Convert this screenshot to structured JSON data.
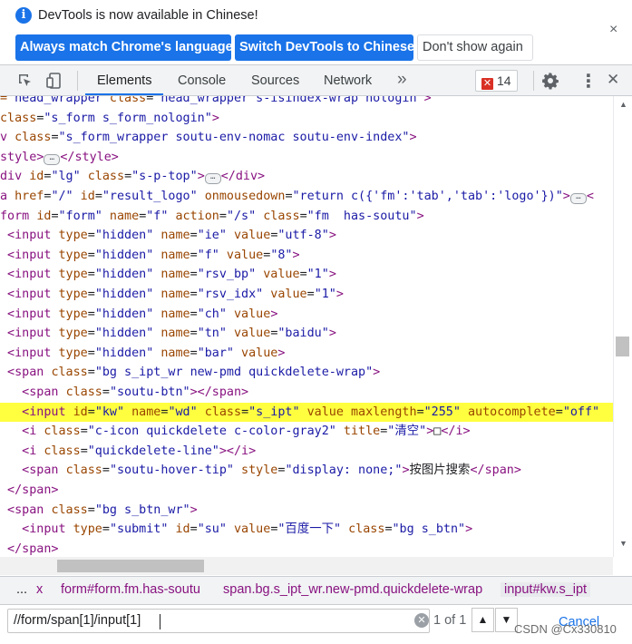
{
  "banner": {
    "message": "DevTools is now available in Chinese!",
    "btn_match": "Always match Chrome's language",
    "btn_switch": "Switch DevTools to Chinese",
    "btn_dont_show": "Don't show again",
    "close": "×",
    "info_glyph": "i"
  },
  "toolbar": {
    "tabs": [
      "Elements",
      "Console",
      "Sources",
      "Network"
    ],
    "more": "»",
    "error_count": "14",
    "error_glyph": "✕",
    "close": "✕",
    "kebab": "⋮"
  },
  "colors": {
    "accent": "#1a73e8",
    "highlight": "#ffff40",
    "tag": "#881280",
    "attr": "#994500",
    "value": "#1a1aa6"
  },
  "code_lines": [
    {
      "segs": [
        [
          "a",
          "= "
        ],
        [
          "v",
          "head_wrapper"
        ],
        [
          "a",
          " class"
        ],
        [
          "x",
          "="
        ],
        [
          "v",
          "\"head_wrapper s-isindex-wrap nologin\""
        ],
        [
          "t",
          ">"
        ]
      ]
    },
    {
      "segs": [
        [
          "a",
          "class"
        ],
        [
          "x",
          "="
        ],
        [
          "v",
          "\"s_form s_form_nologin\""
        ],
        [
          "t",
          ">"
        ]
      ]
    },
    {
      "segs": [
        [
          "t",
          "v "
        ],
        [
          "a",
          "class"
        ],
        [
          "x",
          "="
        ],
        [
          "v",
          "\"s_form_wrapper soutu-env-nomac soutu-env-index\""
        ],
        [
          "t",
          ">"
        ]
      ]
    },
    {
      "segs": [
        [
          "t",
          "style>"
        ],
        [
          "e",
          "…"
        ],
        [
          "t",
          "</style>"
        ]
      ]
    },
    {
      "segs": [
        [
          "t",
          "div "
        ],
        [
          "a",
          "id"
        ],
        [
          "x",
          "="
        ],
        [
          "v",
          "\"lg\""
        ],
        [
          "a",
          " class"
        ],
        [
          "x",
          "="
        ],
        [
          "v",
          "\"s-p-top\""
        ],
        [
          "t",
          ">"
        ],
        [
          "e",
          "…"
        ],
        [
          "t",
          "</div>"
        ]
      ]
    },
    {
      "segs": [
        [
          "t",
          "a "
        ],
        [
          "a",
          "href"
        ],
        [
          "x",
          "="
        ],
        [
          "v",
          "\"/\""
        ],
        [
          "a",
          " id"
        ],
        [
          "x",
          "="
        ],
        [
          "v",
          "\"result_logo\""
        ],
        [
          "a",
          " onmousedown"
        ],
        [
          "x",
          "="
        ],
        [
          "v",
          "\"return c({'fm':'tab','tab':'logo'})\""
        ],
        [
          "t",
          ">"
        ],
        [
          "e",
          "…"
        ],
        [
          "t",
          "<"
        ]
      ]
    },
    {
      "segs": [
        [
          "t",
          "form "
        ],
        [
          "a",
          "id"
        ],
        [
          "x",
          "="
        ],
        [
          "v",
          "\"form\""
        ],
        [
          "a",
          " name"
        ],
        [
          "x",
          "="
        ],
        [
          "v",
          "\"f\""
        ],
        [
          "a",
          " action"
        ],
        [
          "x",
          "="
        ],
        [
          "v",
          "\"/s\""
        ],
        [
          "a",
          " class"
        ],
        [
          "x",
          "="
        ],
        [
          "v",
          "\"fm  has-soutu\""
        ],
        [
          "t",
          ">"
        ]
      ]
    },
    {
      "segs": [
        [
          "t",
          " <input "
        ],
        [
          "a",
          "type"
        ],
        [
          "x",
          "="
        ],
        [
          "v",
          "\"hidden\""
        ],
        [
          "a",
          " name"
        ],
        [
          "x",
          "="
        ],
        [
          "v",
          "\"ie\""
        ],
        [
          "a",
          " value"
        ],
        [
          "x",
          "="
        ],
        [
          "v",
          "\"utf-8\""
        ],
        [
          "t",
          ">"
        ]
      ]
    },
    {
      "segs": [
        [
          "t",
          " <input "
        ],
        [
          "a",
          "type"
        ],
        [
          "x",
          "="
        ],
        [
          "v",
          "\"hidden\""
        ],
        [
          "a",
          " name"
        ],
        [
          "x",
          "="
        ],
        [
          "v",
          "\"f\""
        ],
        [
          "a",
          " value"
        ],
        [
          "x",
          "="
        ],
        [
          "v",
          "\"8\""
        ],
        [
          "t",
          ">"
        ]
      ]
    },
    {
      "segs": [
        [
          "t",
          " <input "
        ],
        [
          "a",
          "type"
        ],
        [
          "x",
          "="
        ],
        [
          "v",
          "\"hidden\""
        ],
        [
          "a",
          " name"
        ],
        [
          "x",
          "="
        ],
        [
          "v",
          "\"rsv_bp\""
        ],
        [
          "a",
          " value"
        ],
        [
          "x",
          "="
        ],
        [
          "v",
          "\"1\""
        ],
        [
          "t",
          ">"
        ]
      ]
    },
    {
      "segs": [
        [
          "t",
          " <input "
        ],
        [
          "a",
          "type"
        ],
        [
          "x",
          "="
        ],
        [
          "v",
          "\"hidden\""
        ],
        [
          "a",
          " name"
        ],
        [
          "x",
          "="
        ],
        [
          "v",
          "\"rsv_idx\""
        ],
        [
          "a",
          " value"
        ],
        [
          "x",
          "="
        ],
        [
          "v",
          "\"1\""
        ],
        [
          "t",
          ">"
        ]
      ]
    },
    {
      "segs": [
        [
          "t",
          " <input "
        ],
        [
          "a",
          "type"
        ],
        [
          "x",
          "="
        ],
        [
          "v",
          "\"hidden\""
        ],
        [
          "a",
          " name"
        ],
        [
          "x",
          "="
        ],
        [
          "v",
          "\"ch\""
        ],
        [
          "a",
          " value"
        ],
        [
          "t",
          ">"
        ]
      ]
    },
    {
      "segs": [
        [
          "t",
          " <input "
        ],
        [
          "a",
          "type"
        ],
        [
          "x",
          "="
        ],
        [
          "v",
          "\"hidden\""
        ],
        [
          "a",
          " name"
        ],
        [
          "x",
          "="
        ],
        [
          "v",
          "\"tn\""
        ],
        [
          "a",
          " value"
        ],
        [
          "x",
          "="
        ],
        [
          "v",
          "\"baidu\""
        ],
        [
          "t",
          ">"
        ]
      ]
    },
    {
      "segs": [
        [
          "t",
          " <input "
        ],
        [
          "a",
          "type"
        ],
        [
          "x",
          "="
        ],
        [
          "v",
          "\"hidden\""
        ],
        [
          "a",
          " name"
        ],
        [
          "x",
          "="
        ],
        [
          "v",
          "\"bar\""
        ],
        [
          "a",
          " value"
        ],
        [
          "t",
          ">"
        ]
      ]
    },
    {
      "segs": [
        [
          "t",
          " <span "
        ],
        [
          "a",
          "class"
        ],
        [
          "x",
          "="
        ],
        [
          "v",
          "\"bg s_ipt_wr new-pmd quickdelete-wrap\""
        ],
        [
          "t",
          ">"
        ]
      ]
    },
    {
      "segs": [
        [
          "t",
          "   <span "
        ],
        [
          "a",
          "class"
        ],
        [
          "x",
          "="
        ],
        [
          "v",
          "\"soutu-btn\""
        ],
        [
          "t",
          "></span>"
        ]
      ]
    },
    {
      "hl": true,
      "segs": [
        [
          "t",
          "   <input "
        ],
        [
          "a",
          "id"
        ],
        [
          "x",
          "="
        ],
        [
          "v",
          "\"kw\""
        ],
        [
          "a",
          " name"
        ],
        [
          "x",
          "="
        ],
        [
          "v",
          "\"wd\""
        ],
        [
          "a",
          " class"
        ],
        [
          "x",
          "="
        ],
        [
          "v",
          "\"s_ipt\""
        ],
        [
          "a",
          " value maxlength"
        ],
        [
          "x",
          "="
        ],
        [
          "v",
          "\"255\""
        ],
        [
          "a",
          " autocomplete"
        ],
        [
          "x",
          "="
        ],
        [
          "v",
          "\"off\""
        ]
      ]
    },
    {
      "segs": [
        [
          "t",
          "   <i "
        ],
        [
          "a",
          "class"
        ],
        [
          "x",
          "="
        ],
        [
          "v",
          "\"c-icon quickdelete c-color-gray2\""
        ],
        [
          "a",
          " title"
        ],
        [
          "x",
          "="
        ],
        [
          "v",
          "\"清空\""
        ],
        [
          "t",
          ">"
        ],
        [
          "x",
          "\u0000"
        ],
        [
          "t",
          "</i>"
        ]
      ]
    },
    {
      "segs": [
        [
          "t",
          "   <i "
        ],
        [
          "a",
          "class"
        ],
        [
          "x",
          "="
        ],
        [
          "v",
          "\"quickdelete-line\""
        ],
        [
          "t",
          "></i>"
        ]
      ]
    },
    {
      "segs": [
        [
          "t",
          "   <span "
        ],
        [
          "a",
          "class"
        ],
        [
          "x",
          "="
        ],
        [
          "v",
          "\"soutu-hover-tip\""
        ],
        [
          "a",
          " style"
        ],
        [
          "x",
          "="
        ],
        [
          "v",
          "\"display: none;\""
        ],
        [
          "t",
          ">"
        ],
        [
          "x",
          "按图片搜索"
        ],
        [
          "t",
          "</span>"
        ]
      ]
    },
    {
      "segs": [
        [
          "t",
          " </span>"
        ]
      ]
    },
    {
      "segs": [
        [
          "t",
          " <span "
        ],
        [
          "a",
          "class"
        ],
        [
          "x",
          "="
        ],
        [
          "v",
          "\"bg s_btn_wr\""
        ],
        [
          "t",
          ">"
        ]
      ]
    },
    {
      "segs": [
        [
          "t",
          "   <input "
        ],
        [
          "a",
          "type"
        ],
        [
          "x",
          "="
        ],
        [
          "v",
          "\"submit\""
        ],
        [
          "a",
          " id"
        ],
        [
          "x",
          "="
        ],
        [
          "v",
          "\"su\""
        ],
        [
          "a",
          " value"
        ],
        [
          "x",
          "="
        ],
        [
          "v",
          "\"百度一下\""
        ],
        [
          "a",
          " class"
        ],
        [
          "x",
          "="
        ],
        [
          "v",
          "\"bg s_btn\""
        ],
        [
          "t",
          ">"
        ]
      ]
    },
    {
      "segs": [
        [
          "t",
          " </span>"
        ]
      ]
    }
  ],
  "breadcrumbs": {
    "items": [
      "x",
      "form#form.fm.has-soutu",
      "span.bg.s_ipt_wr.new-pmd.quickdelete-wrap",
      "input#kw.s_ipt"
    ],
    "more": "..."
  },
  "search": {
    "value": "//form/span[1]/input[1]",
    "match": "1 of 1",
    "up": "▲",
    "down": "▼",
    "cancel": "Cancel",
    "clear": "✕"
  },
  "watermark": "CSDN @Cx330810"
}
